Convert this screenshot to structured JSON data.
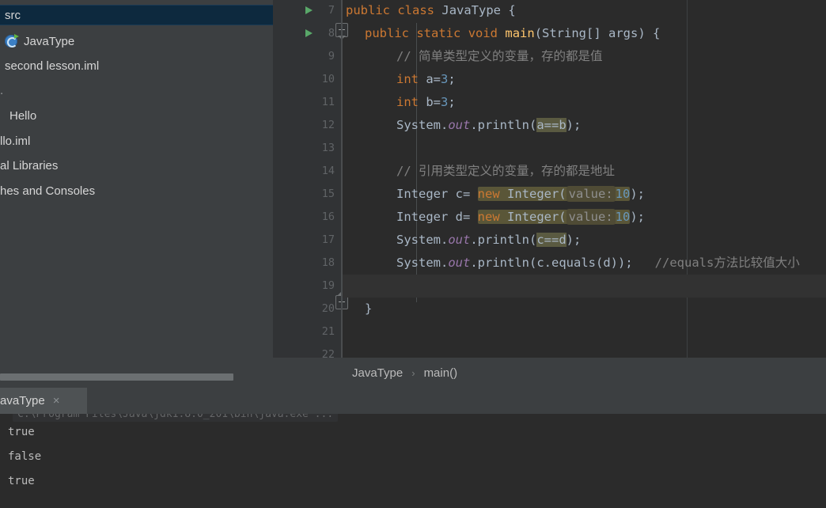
{
  "sidebar": {
    "items": [
      {
        "label": "src",
        "selected": true,
        "icon": "none"
      },
      {
        "label": "JavaType",
        "selected": false,
        "icon": "java-class-icon"
      },
      {
        "label": "second lesson.iml",
        "selected": false,
        "icon": "none"
      },
      {
        "label": "Hello",
        "selected": false,
        "icon": "none"
      },
      {
        "label": "llo.iml",
        "selected": false,
        "icon": "none"
      },
      {
        "label": "al Libraries",
        "selected": false,
        "icon": "none"
      },
      {
        "label": "hes and Consoles",
        "selected": false,
        "icon": "none"
      }
    ],
    "ellipsis": "."
  },
  "editor": {
    "first_line_number": 7,
    "line_numbers": [
      7,
      8,
      9,
      10,
      11,
      12,
      13,
      14,
      15,
      16,
      17,
      18,
      19,
      20,
      21,
      22
    ],
    "current_line": 19,
    "gutter_run_lines": [
      7,
      8
    ],
    "lines": {
      "l7": {
        "kw1": "public",
        "kw2": "class",
        "name": "JavaType",
        "brace": "{"
      },
      "l8": {
        "kw1": "public",
        "kw2": "static",
        "kw3": "void",
        "name": "main",
        "params": "(String[] args)",
        "brace": "{"
      },
      "l9": {
        "comment": "// 简单类型定义的变量，存的都是值"
      },
      "l10": {
        "type": "int",
        "rest": " a=",
        "value": "3",
        "semi": ";"
      },
      "l11": {
        "type": "int",
        "rest": " b=",
        "value": "3",
        "semi": ";"
      },
      "l12": {
        "prefix": "System.",
        "field": "out",
        "method": ".println(",
        "arg": "a==b",
        "suffix": ");"
      },
      "l14": {
        "comment": "// 引用类型定义的变量，存的都是地址"
      },
      "l15": {
        "decl": "Integer c= ",
        "kw": "new",
        "cls": " Integer(",
        "hint": "value:",
        "value": "10",
        "suffix": ");"
      },
      "l16": {
        "decl": "Integer d= ",
        "kw": "new",
        "cls": " Integer(",
        "hint": "value:",
        "value": "10",
        "suffix": ");"
      },
      "l17": {
        "prefix": "System.",
        "field": "out",
        "method": ".println(",
        "arg": "c==d",
        "suffix": ");"
      },
      "l18": {
        "prefix": "System.",
        "field": "out",
        "method": ".println(",
        "arg": "c.equals(d)",
        "suffix": ");",
        "comment": "//equals方法比较值大小"
      },
      "l20": {
        "brace": "}"
      }
    }
  },
  "breadcrumb": {
    "class": "JavaType",
    "separator": "›",
    "method": "main()"
  },
  "run": {
    "tab_label": "avaType",
    "close_icon": "×",
    "command": "C:\\Program Files\\Java\\jdk1.8.0_201\\bin\\java.exe ...",
    "output": [
      "true",
      "false",
      "true"
    ]
  },
  "colors": {
    "editor_bg": "#2b2b2b",
    "panel_bg": "#3c3f41",
    "gutter_bg": "#313335",
    "selection_blue": "#0d293e",
    "keyword_orange": "#cc7832",
    "number_blue": "#6897bb",
    "method_yellow": "#ffc66d",
    "field_purple": "#9876aa",
    "comment_gray": "#808080",
    "text_default": "#a9b7c6",
    "run_green": "#59a869",
    "highlight_olive": "#5a5a41"
  }
}
